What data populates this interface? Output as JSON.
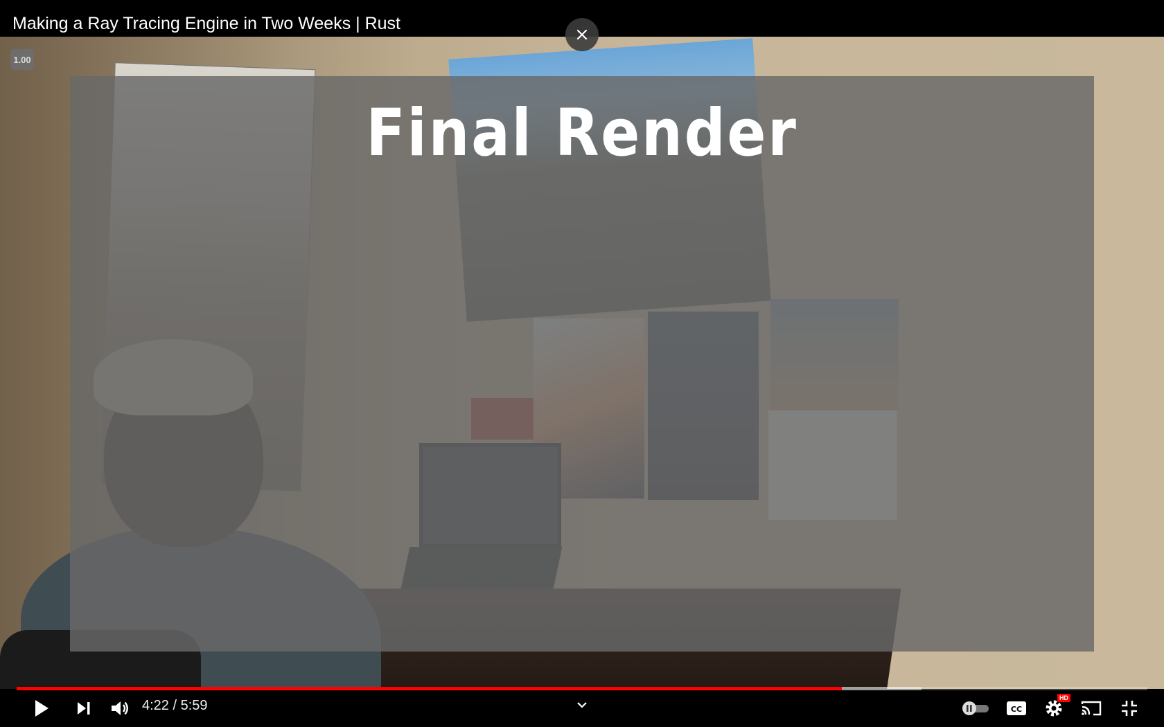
{
  "video": {
    "title": "Making a Ray Tracing Engine in Two Weeks | Rust",
    "overlay_title": "Final Render",
    "playback_speed": "1.00"
  },
  "player": {
    "current_time": "4:22",
    "duration": "5:59",
    "time_separator": " / ",
    "played_fraction": 0.73,
    "buffered_fraction": 0.8,
    "hd_badge": "HD"
  },
  "icons": {
    "close": "close-icon",
    "play": "play-icon",
    "next": "next-icon",
    "volume": "volume-icon",
    "chevron": "chevron-down-icon",
    "autoplay": "autoplay-toggle",
    "captions": "cc-icon",
    "settings": "gear-icon",
    "cast": "cast-icon",
    "fullscreen": "exit-fullscreen-icon"
  },
  "colors": {
    "progress_played": "#ff0000",
    "hd_badge": "#ff0000"
  }
}
